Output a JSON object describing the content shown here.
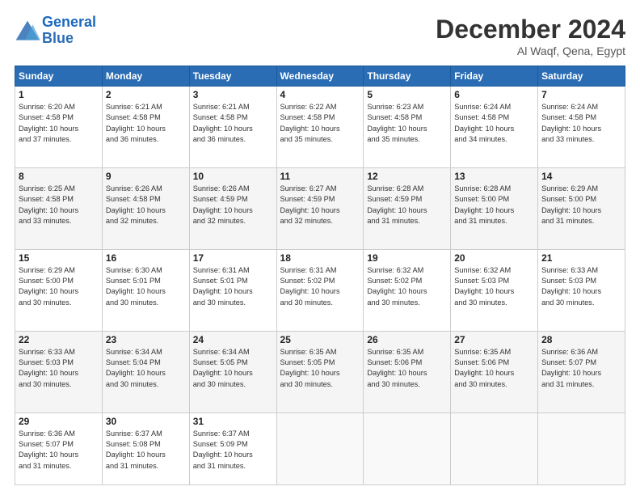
{
  "header": {
    "logo_line1": "General",
    "logo_line2": "Blue",
    "title": "December 2024",
    "subtitle": "Al Waqf, Qena, Egypt"
  },
  "days_of_week": [
    "Sunday",
    "Monday",
    "Tuesday",
    "Wednesday",
    "Thursday",
    "Friday",
    "Saturday"
  ],
  "weeks": [
    [
      {
        "day": 1,
        "info": "Sunrise: 6:20 AM\nSunset: 4:58 PM\nDaylight: 10 hours\nand 37 minutes."
      },
      {
        "day": 2,
        "info": "Sunrise: 6:21 AM\nSunset: 4:58 PM\nDaylight: 10 hours\nand 36 minutes."
      },
      {
        "day": 3,
        "info": "Sunrise: 6:21 AM\nSunset: 4:58 PM\nDaylight: 10 hours\nand 36 minutes."
      },
      {
        "day": 4,
        "info": "Sunrise: 6:22 AM\nSunset: 4:58 PM\nDaylight: 10 hours\nand 35 minutes."
      },
      {
        "day": 5,
        "info": "Sunrise: 6:23 AM\nSunset: 4:58 PM\nDaylight: 10 hours\nand 35 minutes."
      },
      {
        "day": 6,
        "info": "Sunrise: 6:24 AM\nSunset: 4:58 PM\nDaylight: 10 hours\nand 34 minutes."
      },
      {
        "day": 7,
        "info": "Sunrise: 6:24 AM\nSunset: 4:58 PM\nDaylight: 10 hours\nand 33 minutes."
      }
    ],
    [
      {
        "day": 8,
        "info": "Sunrise: 6:25 AM\nSunset: 4:58 PM\nDaylight: 10 hours\nand 33 minutes."
      },
      {
        "day": 9,
        "info": "Sunrise: 6:26 AM\nSunset: 4:58 PM\nDaylight: 10 hours\nand 32 minutes."
      },
      {
        "day": 10,
        "info": "Sunrise: 6:26 AM\nSunset: 4:59 PM\nDaylight: 10 hours\nand 32 minutes."
      },
      {
        "day": 11,
        "info": "Sunrise: 6:27 AM\nSunset: 4:59 PM\nDaylight: 10 hours\nand 32 minutes."
      },
      {
        "day": 12,
        "info": "Sunrise: 6:28 AM\nSunset: 4:59 PM\nDaylight: 10 hours\nand 31 minutes."
      },
      {
        "day": 13,
        "info": "Sunrise: 6:28 AM\nSunset: 5:00 PM\nDaylight: 10 hours\nand 31 minutes."
      },
      {
        "day": 14,
        "info": "Sunrise: 6:29 AM\nSunset: 5:00 PM\nDaylight: 10 hours\nand 31 minutes."
      }
    ],
    [
      {
        "day": 15,
        "info": "Sunrise: 6:29 AM\nSunset: 5:00 PM\nDaylight: 10 hours\nand 30 minutes."
      },
      {
        "day": 16,
        "info": "Sunrise: 6:30 AM\nSunset: 5:01 PM\nDaylight: 10 hours\nand 30 minutes."
      },
      {
        "day": 17,
        "info": "Sunrise: 6:31 AM\nSunset: 5:01 PM\nDaylight: 10 hours\nand 30 minutes."
      },
      {
        "day": 18,
        "info": "Sunrise: 6:31 AM\nSunset: 5:02 PM\nDaylight: 10 hours\nand 30 minutes."
      },
      {
        "day": 19,
        "info": "Sunrise: 6:32 AM\nSunset: 5:02 PM\nDaylight: 10 hours\nand 30 minutes."
      },
      {
        "day": 20,
        "info": "Sunrise: 6:32 AM\nSunset: 5:03 PM\nDaylight: 10 hours\nand 30 minutes."
      },
      {
        "day": 21,
        "info": "Sunrise: 6:33 AM\nSunset: 5:03 PM\nDaylight: 10 hours\nand 30 minutes."
      }
    ],
    [
      {
        "day": 22,
        "info": "Sunrise: 6:33 AM\nSunset: 5:03 PM\nDaylight: 10 hours\nand 30 minutes."
      },
      {
        "day": 23,
        "info": "Sunrise: 6:34 AM\nSunset: 5:04 PM\nDaylight: 10 hours\nand 30 minutes."
      },
      {
        "day": 24,
        "info": "Sunrise: 6:34 AM\nSunset: 5:05 PM\nDaylight: 10 hours\nand 30 minutes."
      },
      {
        "day": 25,
        "info": "Sunrise: 6:35 AM\nSunset: 5:05 PM\nDaylight: 10 hours\nand 30 minutes."
      },
      {
        "day": 26,
        "info": "Sunrise: 6:35 AM\nSunset: 5:06 PM\nDaylight: 10 hours\nand 30 minutes."
      },
      {
        "day": 27,
        "info": "Sunrise: 6:35 AM\nSunset: 5:06 PM\nDaylight: 10 hours\nand 30 minutes."
      },
      {
        "day": 28,
        "info": "Sunrise: 6:36 AM\nSunset: 5:07 PM\nDaylight: 10 hours\nand 31 minutes."
      }
    ],
    [
      {
        "day": 29,
        "info": "Sunrise: 6:36 AM\nSunset: 5:07 PM\nDaylight: 10 hours\nand 31 minutes."
      },
      {
        "day": 30,
        "info": "Sunrise: 6:37 AM\nSunset: 5:08 PM\nDaylight: 10 hours\nand 31 minutes."
      },
      {
        "day": 31,
        "info": "Sunrise: 6:37 AM\nSunset: 5:09 PM\nDaylight: 10 hours\nand 31 minutes."
      },
      {
        "day": null,
        "info": ""
      },
      {
        "day": null,
        "info": ""
      },
      {
        "day": null,
        "info": ""
      },
      {
        "day": null,
        "info": ""
      }
    ]
  ]
}
